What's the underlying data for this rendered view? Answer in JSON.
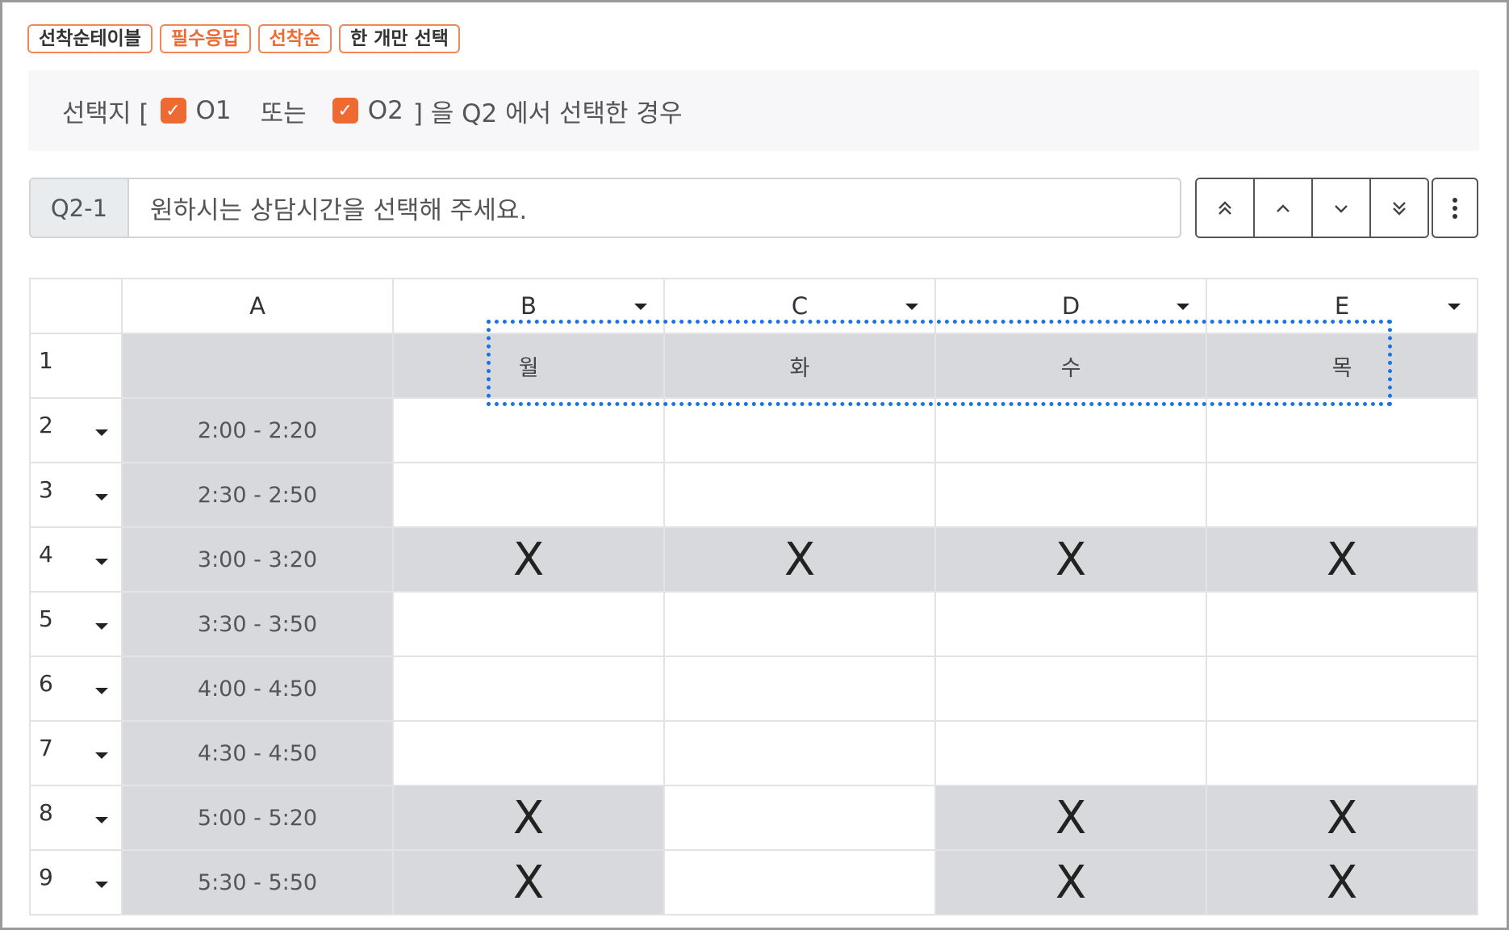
{
  "tags": [
    "선착순테이블",
    "필수응답",
    "선착순",
    "한 개만 선택"
  ],
  "condition": {
    "prefix": "선택지 [",
    "opt1": "O1",
    "or": "또는",
    "opt2": "O2",
    "suffix": "] 을 Q2 에서 선택한 경우"
  },
  "question": {
    "id": "Q2-1",
    "text": "원하시는 상담시간을 선택해 주세요."
  },
  "nav": [
    "move-top",
    "move-up",
    "move-down",
    "move-bottom"
  ],
  "grid": {
    "columns": [
      "A",
      "B",
      "C",
      "D",
      "E"
    ],
    "rows": [
      {
        "num": "1",
        "a": "",
        "cells": [
          "월",
          "화",
          "수",
          "목"
        ]
      },
      {
        "num": "2",
        "a": "2:00 - 2:20",
        "cells": [
          "",
          "",
          "",
          ""
        ]
      },
      {
        "num": "3",
        "a": "2:30 - 2:50",
        "cells": [
          "",
          "",
          "",
          ""
        ]
      },
      {
        "num": "4",
        "a": "3:00 - 3:20",
        "cells": [
          "X",
          "X",
          "X",
          "X"
        ]
      },
      {
        "num": "5",
        "a": "3:30 - 3:50",
        "cells": [
          "",
          "",
          "",
          ""
        ]
      },
      {
        "num": "6",
        "a": "4:00 - 4:50",
        "cells": [
          "",
          "",
          "",
          ""
        ]
      },
      {
        "num": "7",
        "a": "4:30 - 4:50",
        "cells": [
          "",
          "",
          "",
          ""
        ]
      },
      {
        "num": "8",
        "a": "5:00 - 5:20",
        "cells": [
          "X",
          "",
          "X",
          "X"
        ]
      },
      {
        "num": "9",
        "a": "5:30 - 5:50",
        "cells": [
          "X",
          "",
          "X",
          "X"
        ]
      }
    ]
  },
  "colors": {
    "accent": "#ee6a33",
    "shade": "#d7d9dc",
    "selection": "#1a73e8"
  }
}
